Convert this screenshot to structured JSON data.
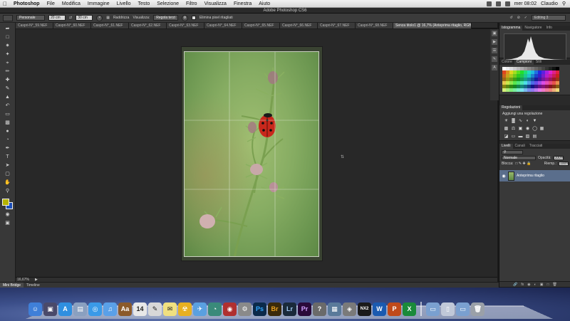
{
  "menubar": {
    "app_name": "Photoshop",
    "items": [
      "File",
      "Modifica",
      "Immagine",
      "Livello",
      "Testo",
      "Selezione",
      "Filtro",
      "Visualizza",
      "Finestra",
      "Aiuto"
    ],
    "clock": "mer 08:02",
    "user": "Claudio"
  },
  "window_title": "Adobe Photoshop CS6",
  "options_bar": {
    "ratio_preset": "Personale",
    "width": "20 cm",
    "height": "30 cm",
    "straighten_label": "Raddrizza",
    "view_label": "Visualizza:",
    "view_value": "Regola terzi",
    "delete_pixels_label": "Elimina pixel ritagliati",
    "workspace": "Editing 3"
  },
  "tabs": [
    {
      "label": "Caspri-N°_59.NEF"
    },
    {
      "label": "Caspri-N°_60.NEF"
    },
    {
      "label": "Caspri-N°_61.NEF"
    },
    {
      "label": "Caspri-N°_62.NEF"
    },
    {
      "label": "Caspri-N°_63.NEF"
    },
    {
      "label": "Caspri-N°_64.NEF"
    },
    {
      "label": "Caspri-N°_65.NEF"
    },
    {
      "label": "Caspri-N°_66.NEF"
    },
    {
      "label": "Caspri-N°_67.NEF"
    },
    {
      "label": "Caspri-N°_68.NEF"
    },
    {
      "label": "Senza titolo1 @ 16,7% (Anteprima ritaglio, RGB/8) *",
      "active": true
    }
  ],
  "status": {
    "zoom": "16,67%"
  },
  "bottom_tabs": [
    "Mini Bridge",
    "Timeline"
  ],
  "panels": {
    "histogram_tabs": [
      "Istogramma",
      "Navigatore",
      "Info"
    ],
    "swatches_tabs": [
      "Colore",
      "Campioni",
      "Stili"
    ],
    "adjustments_tab": "Regolazioni",
    "adjustments_title": "Aggiungi una regolazione",
    "layers_tabs": [
      "Livelli",
      "Canali",
      "Tracciati"
    ],
    "blend_mode": "Normale",
    "opacity_label": "Opacità:",
    "opacity": "100%",
    "lock_label": "Blocca:",
    "fill_label": "Riemp.:",
    "fill": "100%",
    "layer_name": "Anteprima ritaglio"
  },
  "dock_apps": [
    {
      "name": "finder",
      "glyph": "☺",
      "color": "#3f7fd8"
    },
    {
      "name": "mission-control",
      "glyph": "▣",
      "color": "#4a4a6a"
    },
    {
      "name": "app-store",
      "glyph": "A",
      "color": "#2f8fe0"
    },
    {
      "name": "preview",
      "glyph": "▤",
      "color": "#8aa0c0"
    },
    {
      "name": "safari",
      "glyph": "◎",
      "color": "#3a9ae8"
    },
    {
      "name": "itunes",
      "glyph": "♫",
      "color": "#5aa0e8"
    },
    {
      "name": "dictionary",
      "glyph": "Aa",
      "color": "#8b5a2b"
    },
    {
      "name": "calendar",
      "glyph": "14",
      "color": "#e8e8e8"
    },
    {
      "name": "textedit",
      "glyph": "✎",
      "color": "#d8d8d8"
    },
    {
      "name": "notes",
      "glyph": "✉",
      "color": "#f0e080"
    },
    {
      "name": "radioactive-app",
      "glyph": "☢",
      "color": "#e8b020"
    },
    {
      "name": "mail",
      "glyph": "✈",
      "color": "#5aa0e0"
    },
    {
      "name": "time-machine",
      "glyph": "◔",
      "color": "#3a8a7a"
    },
    {
      "name": "photo-booth",
      "glyph": "◉",
      "color": "#b03030"
    },
    {
      "name": "system-preferences",
      "glyph": "⚙",
      "color": "#8a8a8a"
    },
    {
      "name": "photoshop",
      "glyph": "Ps",
      "color": "#0b2a4a"
    },
    {
      "name": "bridge",
      "glyph": "Br",
      "color": "#3a2a0a"
    },
    {
      "name": "lightroom",
      "glyph": "Lr",
      "color": "#1a2a3a"
    },
    {
      "name": "premiere",
      "glyph": "Pr",
      "color": "#2a0a3a"
    },
    {
      "name": "help",
      "glyph": "?",
      "color": "#6a6a6a"
    },
    {
      "name": "photo-app",
      "glyph": "▦",
      "color": "#5a7a9a"
    },
    {
      "name": "camera-app",
      "glyph": "◈",
      "color": "#7a7a7a"
    },
    {
      "name": "nx2",
      "glyph": "NX2",
      "color": "#1a1a1a"
    },
    {
      "name": "word",
      "glyph": "W",
      "color": "#1a5ab0"
    },
    {
      "name": "powerpoint",
      "glyph": "P",
      "color": "#c04a1a"
    },
    {
      "name": "excel",
      "glyph": "X",
      "color": "#1a8a3a"
    },
    {
      "name": "applications-folder",
      "glyph": "▭",
      "color": "#7aa0d0"
    },
    {
      "name": "documents-folder",
      "glyph": "▯",
      "color": "#c0c8d8"
    },
    {
      "name": "downloads-folder",
      "glyph": "▭",
      "color": "#7aa0d0"
    },
    {
      "name": "trash",
      "glyph": "🗑",
      "color": "#9aa0a8"
    }
  ]
}
